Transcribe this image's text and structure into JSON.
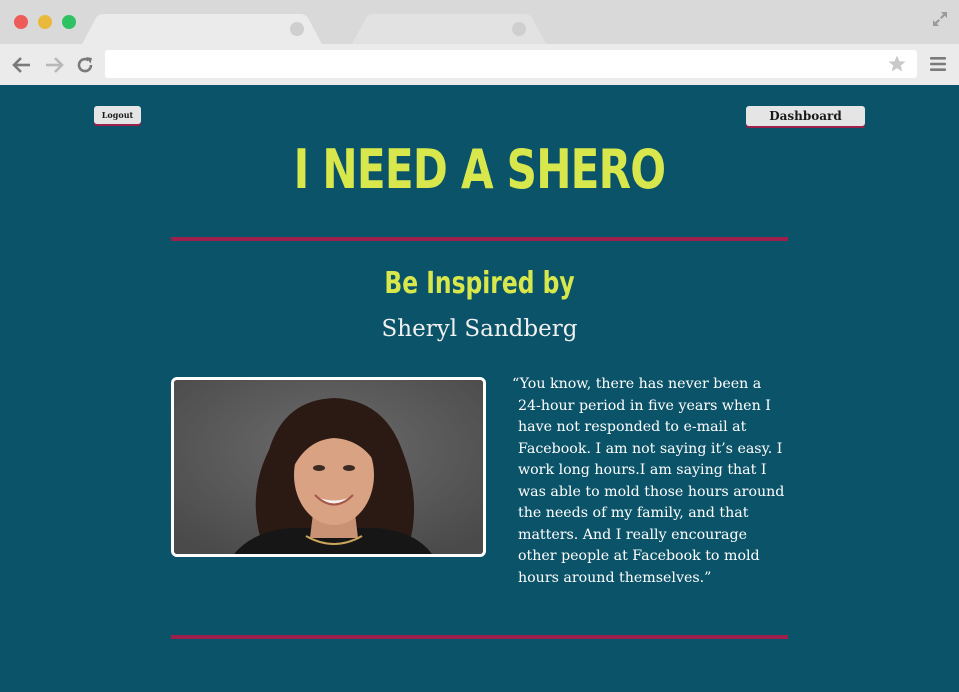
{
  "browser": {
    "url": "",
    "icons": {
      "back": "back-arrow-icon",
      "forward": "forward-arrow-icon",
      "reload": "reload-icon",
      "bookmark": "star-icon",
      "menu": "hamburger-menu-icon",
      "fullscreen": "expand-icon"
    }
  },
  "header": {
    "logout_label": "Logout",
    "dashboard_label": "Dashboard"
  },
  "hero": {
    "title": "I NEED A SHERO",
    "subtitle": "Be Inspired by",
    "name": "Sheryl Sandberg"
  },
  "quote": {
    "text": "“You know, there has never been a 24-hour period in five years when I have not responded to e-mail at Facebook. I am not saying it’s easy. I work long hours.I am saying that I was able to mold those hours around the needs of my family, and that matters. And I really encourage other people at Facebook to mold hours around themselves.”"
  },
  "colors": {
    "page_background": "#0b5368",
    "accent_yellow": "#d8e84c",
    "divider_magenta": "#9c1f4c",
    "button_background": "#e5e5e5"
  }
}
